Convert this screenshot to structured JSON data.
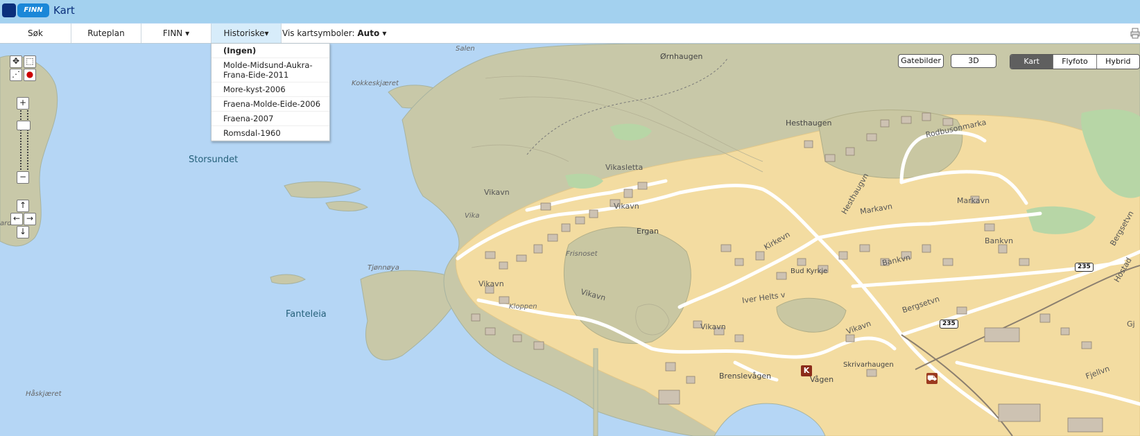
{
  "app": {
    "logo_text": "FINN",
    "title": "Kart"
  },
  "toolbar": {
    "items": [
      {
        "label": "Søk"
      },
      {
        "label": "Ruteplan"
      },
      {
        "label": "FINN ▾"
      },
      {
        "label": "Historiske▾"
      }
    ],
    "symbols_label": "Vis kartsymboler:",
    "symbols_value": "Auto ▾"
  },
  "historic_menu": [
    {
      "label": "(Ingen)",
      "selected": true
    },
    {
      "label": "Molde-Midsund-Aukra-Frana-Eide-2011"
    },
    {
      "label": "More-kyst-2006"
    },
    {
      "label": "Fraena-Molde-Eide-2006"
    },
    {
      "label": "Fraena-2007"
    },
    {
      "label": "Romsdal-1960"
    }
  ],
  "map_types": {
    "gatebilder": "Gatebilder",
    "threeD": "3D",
    "kart": "Kart",
    "flyfoto": "Flyfoto",
    "hybrid": "Hybrid",
    "active": "Kart"
  },
  "controls": {
    "zoom_in": "+",
    "zoom_out": "−",
    "pan_up": "↑",
    "pan_down": "↓",
    "pan_left": "←",
    "pan_right": "→"
  },
  "map_labels": {
    "salen": "Salen",
    "ornhaugen": "Ørnhaugen",
    "kokkeskjaret": "Kokkeskjæret",
    "hesthaugen": "Hesthaugen",
    "storsundet": "Storsundet",
    "vikasletta": "Vikasletta",
    "vikavn": "Vikavn",
    "rodbusonmarka": "Rodbusonmarka",
    "hesthaugvn": "Hesthaugvn",
    "markavn": "Markavn",
    "vika": "Vika",
    "ergan": "Ergan",
    "kirkevn": "Kirkevn",
    "frisnoset": "Frisnoset",
    "bankvn": "Bankvn",
    "bergsetvn": "Bergsetvn",
    "hostadvn": "Hostad",
    "bud_kyrkje": "Bud Kyrkje",
    "tjonnoya": "Tjønnøya",
    "kloppen": "Kloppen",
    "fanteleia": "Fanteleia",
    "iver_helts_v": "Iver Helts v",
    "brenslevagen": "Brenslevågen",
    "skrivarhaugen": "Skrivarhaugen",
    "vagen": "Vågen",
    "haskjaret": "Håskjæret",
    "ardro": "ardro",
    "gj": "Gj",
    "fjellvn": "Fjellvn",
    "road_235": "235",
    "poi_k": "K"
  }
}
